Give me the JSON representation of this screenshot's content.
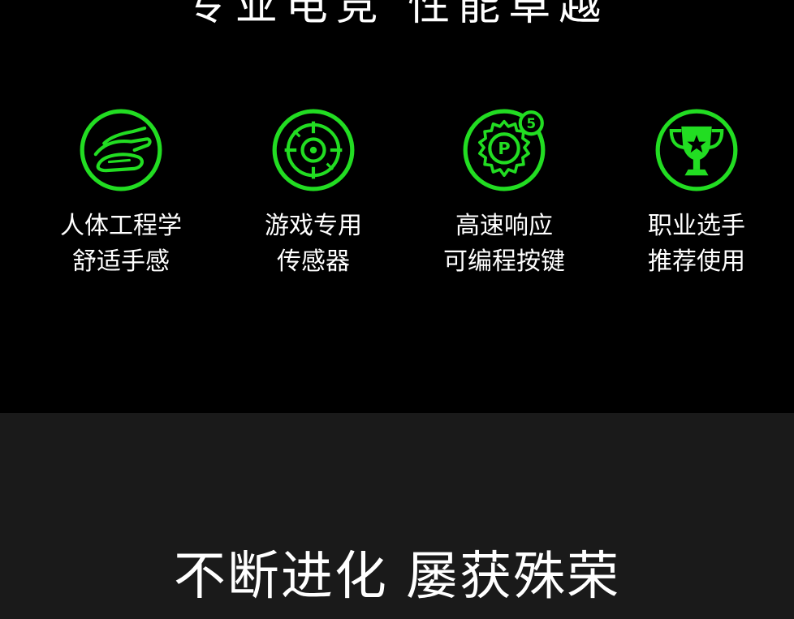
{
  "header": {
    "cut_title": "专业电竞 性能卓越"
  },
  "features": [
    {
      "icon": "hand-mouse-icon",
      "line1": "人体工程学",
      "line2": "舒适手感"
    },
    {
      "icon": "crosshair-sensor-icon",
      "line1": "游戏专用",
      "line2": "传感器"
    },
    {
      "icon": "programmable-gear-icon",
      "badge": "5",
      "line1": "高速响应",
      "line2": "可编程按键"
    },
    {
      "icon": "trophy-icon",
      "line1": "职业选手",
      "line2": "推荐使用"
    }
  ],
  "section2": {
    "title": "不断进化 屡获殊荣"
  },
  "colors": {
    "accent": "#22dd22",
    "background_top": "#000000",
    "background_bottom": "#1a1a1a",
    "text": "#ffffff"
  }
}
